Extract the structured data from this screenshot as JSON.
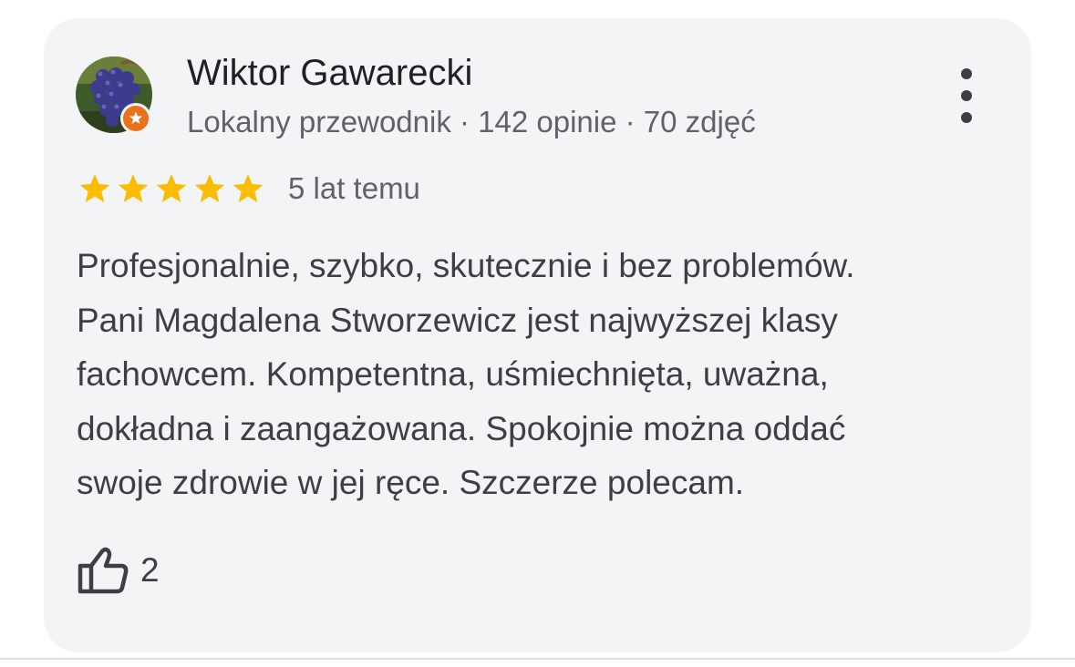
{
  "review": {
    "author_name": "Wiktor Gawarecki",
    "author_meta": "Lokalny przewodnik · 142 opinie · 70 zdjęć",
    "avatar_icon": "grapes-photo",
    "badge_icon": "local-guide-star-badge",
    "rating": 5,
    "rating_max": 5,
    "time_ago": "5 lat temu",
    "text_lines": [
      "Profesjonalnie, szybko, skutecznie i bez problemów.",
      "Pani Magdalena Stworzewicz jest najwyższej klasy",
      "fachowcem. Kompetentna, uśmiechnięta, uważna,",
      "dokładna i zaangażowana. Spokojnie można oddać",
      "swoje zdrowie w jej ręce. Szczerze polecam."
    ],
    "like_count": "2",
    "like_icon": "thumbs-up-icon",
    "more_icon": "more-vert-icon"
  },
  "colors": {
    "card_background": "#f3f4f6",
    "star": "#fbbc04",
    "badge": "#e8711c",
    "primary_text": "#202124",
    "secondary_text": "#5f6368"
  }
}
